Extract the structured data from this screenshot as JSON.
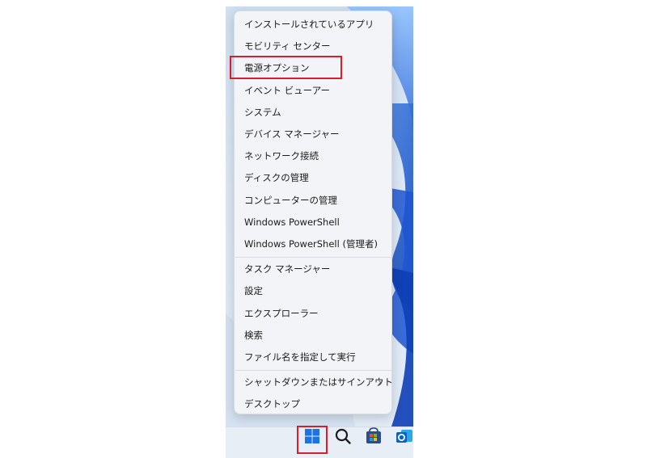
{
  "context_menu": {
    "groups": [
      [
        {
          "label": "インストールされているアプリ"
        },
        {
          "label": "モビリティ センター"
        },
        {
          "label": "電源オプション",
          "highlighted": true
        },
        {
          "label": "イベント ビューアー"
        },
        {
          "label": "システム"
        },
        {
          "label": "デバイス マネージャー"
        },
        {
          "label": "ネットワーク接続"
        },
        {
          "label": "ディスクの管理"
        },
        {
          "label": "コンピューターの管理"
        },
        {
          "label": "Windows PowerShell"
        },
        {
          "label": "Windows PowerShell (管理者)"
        }
      ],
      [
        {
          "label": "タスク マネージャー"
        },
        {
          "label": "設定"
        },
        {
          "label": "エクスプローラー"
        },
        {
          "label": "検索"
        },
        {
          "label": "ファイル名を指定して実行"
        }
      ],
      [
        {
          "label": "シャットダウンまたはサインアウト",
          "submenu_chevron": "›"
        },
        {
          "label": "デスクトップ"
        }
      ]
    ]
  },
  "taskbar": {
    "icons": [
      "windows-start-icon",
      "search-icon",
      "microsoft-store-icon",
      "outlook-icon"
    ],
    "start_highlighted": true
  },
  "colors": {
    "highlight_border": "#d61f2c",
    "menu_background": "#f3f4f7",
    "wallpaper_accent": "#1f5fd6"
  }
}
